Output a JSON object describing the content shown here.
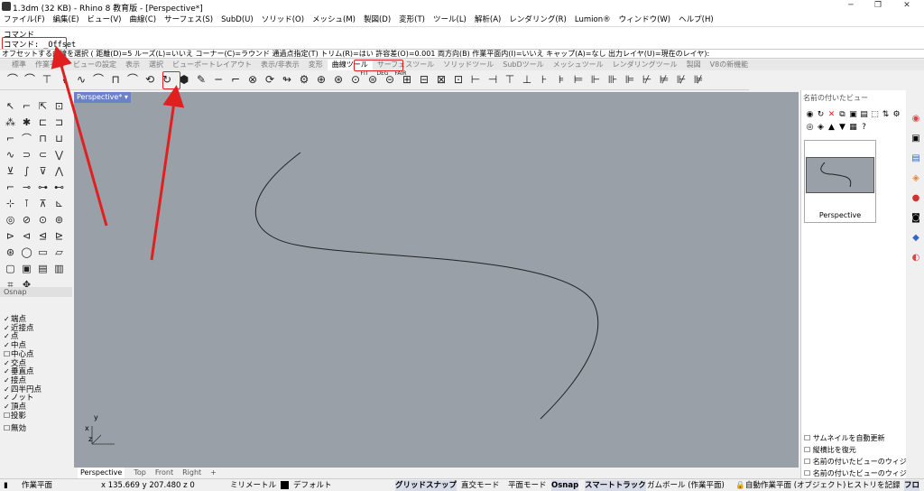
{
  "window": {
    "title": "1.3dm (32 KB) - Rhino 8 教育版 - [Perspective*]"
  },
  "menu": [
    "ファイル(F)",
    "編集(E)",
    "ビュー(V)",
    "曲線(C)",
    "サーフェス(S)",
    "SubD(U)",
    "ソリッド(O)",
    "メッシュ(M)",
    "製図(D)",
    "変形(T)",
    "ツール(L)",
    "解析(A)",
    "レンダリング(R)",
    "Lumion®",
    "ウィンドウ(W)",
    "ヘルプ(H)"
  ],
  "command": {
    "history_line1": "コマンド",
    "history_line2": "コマンド: _Offset",
    "prompt": "オフセットする曲線を選択 ( 距離(D)=5 ルーズ(L)=いいえ コーナー(C)=ラウンド 通過点指定(T) トリム(R)=はい 許容差(O)=0.001 両方向(B) 作業平面内(I)=いいえ キャップ(A)=なし 出力レイヤ(U)=現在のレイヤ):"
  },
  "tabs": [
    "標準",
    "作業平面",
    "ビューの設定",
    "表示",
    "選択",
    "ビューポートレイアウト",
    "表示/非表示",
    "変形",
    "曲線ツール",
    "サーフェスツール",
    "ソリッドツール",
    "SubDツール",
    "メッシュツール",
    "レンダリングツール",
    "製図",
    "V8の新機能"
  ],
  "active_tab": "曲線ツール",
  "toolbar_icons": [
    "⌒",
    "⌒",
    "⊤",
    "⌇",
    "∿",
    "⌒",
    "⊓",
    "⌒",
    "⟲",
    "↻",
    "⬢",
    "✎",
    "─",
    "⌐",
    "⊗",
    "⟳",
    "↬",
    "⚙",
    "⊕",
    "⊛",
    "⊙",
    "⊜",
    "⊝",
    "⊞",
    "⊟",
    "⊠",
    "⊡",
    "⊢",
    "⊣",
    "⊤",
    "⊥",
    "⊦",
    "⊧",
    "⊨",
    "⊩",
    "⊪",
    "⊫",
    "⊬",
    "⊭",
    "⊮",
    "⊯"
  ],
  "fit_labels": [
    "FIT",
    "DEG",
    "FAIR"
  ],
  "left_tools": [
    "↖",
    "⌐",
    "⇱",
    "⊡",
    "⁂",
    "✱",
    "⊏",
    "⊐",
    "⌐",
    "⌒",
    "⊓",
    "⊔",
    "∿",
    "⊃",
    "⊂",
    "⋁",
    "⊻",
    "∫",
    "⊽",
    "⋀",
    "⌐",
    "⊸",
    "⊶",
    "⊷",
    "⊹",
    "⊺",
    "⊼",
    "⊾",
    "◎",
    "⊘",
    "⊙",
    "⊚",
    "⊳",
    "⊲",
    "⊴",
    "⊵",
    "⊛",
    "◯",
    "▭",
    "▱",
    "▢",
    "▣",
    "▤",
    "▥",
    "⌗",
    "✥"
  ],
  "osnap": {
    "title": "Osnap",
    "items": [
      {
        "label": "端点",
        "checked": true
      },
      {
        "label": "近接点",
        "checked": true
      },
      {
        "label": "点",
        "checked": true
      },
      {
        "label": "中点",
        "checked": true
      },
      {
        "label": "中心点",
        "checked": false
      },
      {
        "label": "交点",
        "checked": true
      },
      {
        "label": "垂直点",
        "checked": true
      },
      {
        "label": "接点",
        "checked": true
      },
      {
        "label": "四半円点",
        "checked": true
      },
      {
        "label": "ノット",
        "checked": true
      },
      {
        "label": "頂点",
        "checked": true
      },
      {
        "label": "投影",
        "checked": false
      },
      {
        "label": "無効",
        "checked": false
      }
    ]
  },
  "viewport": {
    "label": "Perspective*",
    "axis_x": "x",
    "axis_y": "y",
    "axis_z": "z"
  },
  "viewport_tabs": [
    "Perspective",
    "Top",
    "Front",
    "Right",
    "+"
  ],
  "right_panel": {
    "title": "名前の付いたビュー",
    "thumb_caption": "Perspective",
    "options": [
      {
        "label": "サムネイルを自動更新",
        "checked": false
      },
      {
        "label": "縦横比を復元",
        "checked": false
      },
      {
        "label": "名前の付いたビューのウィジェ",
        "checked": false
      },
      {
        "label": "名前の付いたビューのウィジェ",
        "checked": false
      }
    ]
  },
  "status": {
    "plane": "作業平面",
    "coords": "x 135.669  y 207.480  z 0",
    "unit": "ミリメートル",
    "layer": "デフォルト",
    "grid_snap": "グリッドスナップ",
    "ortho": "直交モード",
    "planar": "平面モード",
    "osnap": "Osnap",
    "smart_track": "スマートトラック",
    "gumball": "ガムボール (作業平面)",
    "auto_cplane": "自動作業平面 (オブジェクト)",
    "history": "ヒストリを記録",
    "filter": "フロ"
  },
  "colors": {
    "viewport": "#99a0a8",
    "active_label": "#6b82c8",
    "annotation_red": "#e02020"
  }
}
